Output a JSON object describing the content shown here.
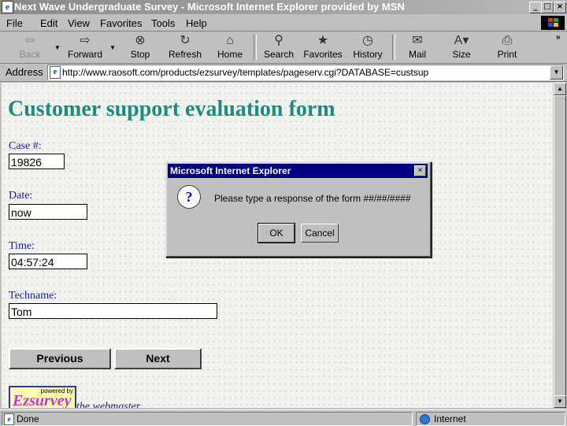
{
  "window": {
    "title": "Next Wave Undergraduate Survey - Microsoft Internet Explorer provided by MSN",
    "controls": {
      "minimize": "_",
      "maximize": "□",
      "close": "×"
    }
  },
  "menu": {
    "items": [
      "File",
      "Edit",
      "View",
      "Favorites",
      "Tools",
      "Help"
    ]
  },
  "toolbar": {
    "buttons": [
      {
        "label": "Back",
        "icon": "back-arrow-icon",
        "enabled": false
      },
      {
        "label": "Forward",
        "icon": "forward-arrow-icon",
        "enabled": true
      },
      {
        "label": "Stop",
        "icon": "stop-icon",
        "enabled": true
      },
      {
        "label": "Refresh",
        "icon": "refresh-icon",
        "enabled": true
      },
      {
        "label": "Home",
        "icon": "home-icon",
        "enabled": true
      },
      {
        "label": "Search",
        "icon": "search-icon",
        "enabled": true
      },
      {
        "label": "Favorites",
        "icon": "favorites-icon",
        "enabled": true
      },
      {
        "label": "History",
        "icon": "history-icon",
        "enabled": true
      },
      {
        "label": "Mail",
        "icon": "mail-icon",
        "enabled": true
      },
      {
        "label": "Size",
        "icon": "size-icon",
        "enabled": true
      },
      {
        "label": "Print",
        "icon": "print-icon",
        "enabled": true
      }
    ]
  },
  "address": {
    "label": "Address",
    "url": "http://www.raosoft.com/products/ezsurvey/templates/pageserv.cgi?DATABASE=custsup"
  },
  "page": {
    "title": "Customer support evaluation form",
    "fields": [
      {
        "label": "Case #:",
        "value": "19826"
      },
      {
        "label": "Date:",
        "value": "now"
      },
      {
        "label": "Time:",
        "value": "04:57:24"
      },
      {
        "label": "Techname:",
        "value": "Tom"
      }
    ],
    "buttons": {
      "previous": "Previous",
      "next": "Next"
    },
    "logo": {
      "powered_by": "powered by",
      "brand": "Ezsurvey"
    },
    "webmaster_link": "the webmaster"
  },
  "status": {
    "text": "Done",
    "zone": "Internet"
  },
  "dialog": {
    "title": "Microsoft Internet Explorer",
    "message": "Please type a response of the form ##/##/####",
    "ok": "OK",
    "cancel": "Cancel",
    "icon": "question-icon"
  },
  "colors": {
    "title_teal": "#1f8a80",
    "label_blue": "#1a1aa6",
    "dialog_title": "#000080"
  }
}
